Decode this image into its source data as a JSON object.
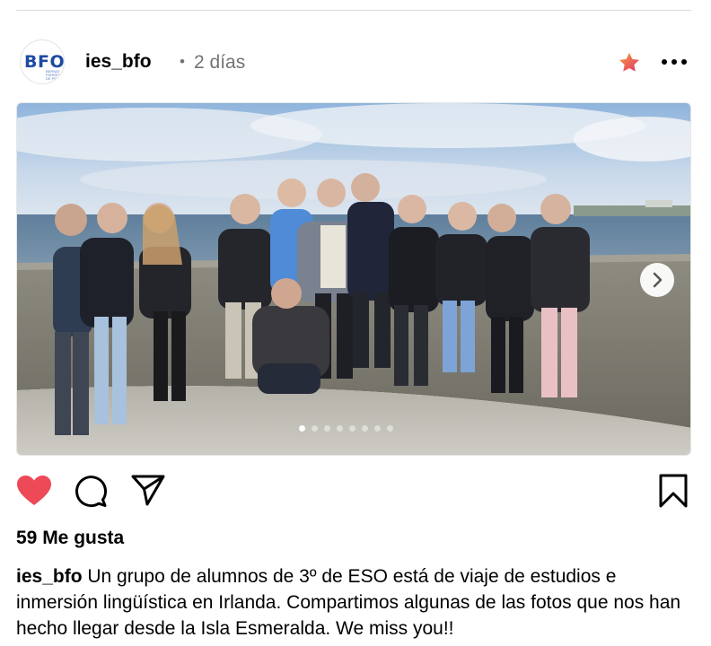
{
  "post": {
    "username": "ies_bfo",
    "separator": "•",
    "time": "2 días",
    "avatar": {
      "logo_text": "BFO",
      "logo_sub": "BERNAT FERRET DE PRIMA",
      "brand_color": "#1f4aa0"
    },
    "photo": {
      "description_icon": "photo",
      "slide_count": 8,
      "active_slide": 1
    },
    "likes_text": "59 Me gusta",
    "caption_user": "ies_bfo",
    "caption_text": " Un grupo de alumnos de 3º de ESO está de viaje de estudios e inmersión lingüística en Irlanda. Compartimos algunas de las fotos que nos han hecho llegar desde la Isla Esmeralda. We miss you!!"
  },
  "icons": {
    "favorite": "star-icon",
    "more": "more-icon",
    "like": "heart-icon",
    "comment": "comment-icon",
    "share": "send-icon",
    "save": "bookmark-icon",
    "next": "chevron-right-icon"
  },
  "colors": {
    "like": "#ed4956",
    "text": "#000000",
    "muted": "#737373"
  }
}
